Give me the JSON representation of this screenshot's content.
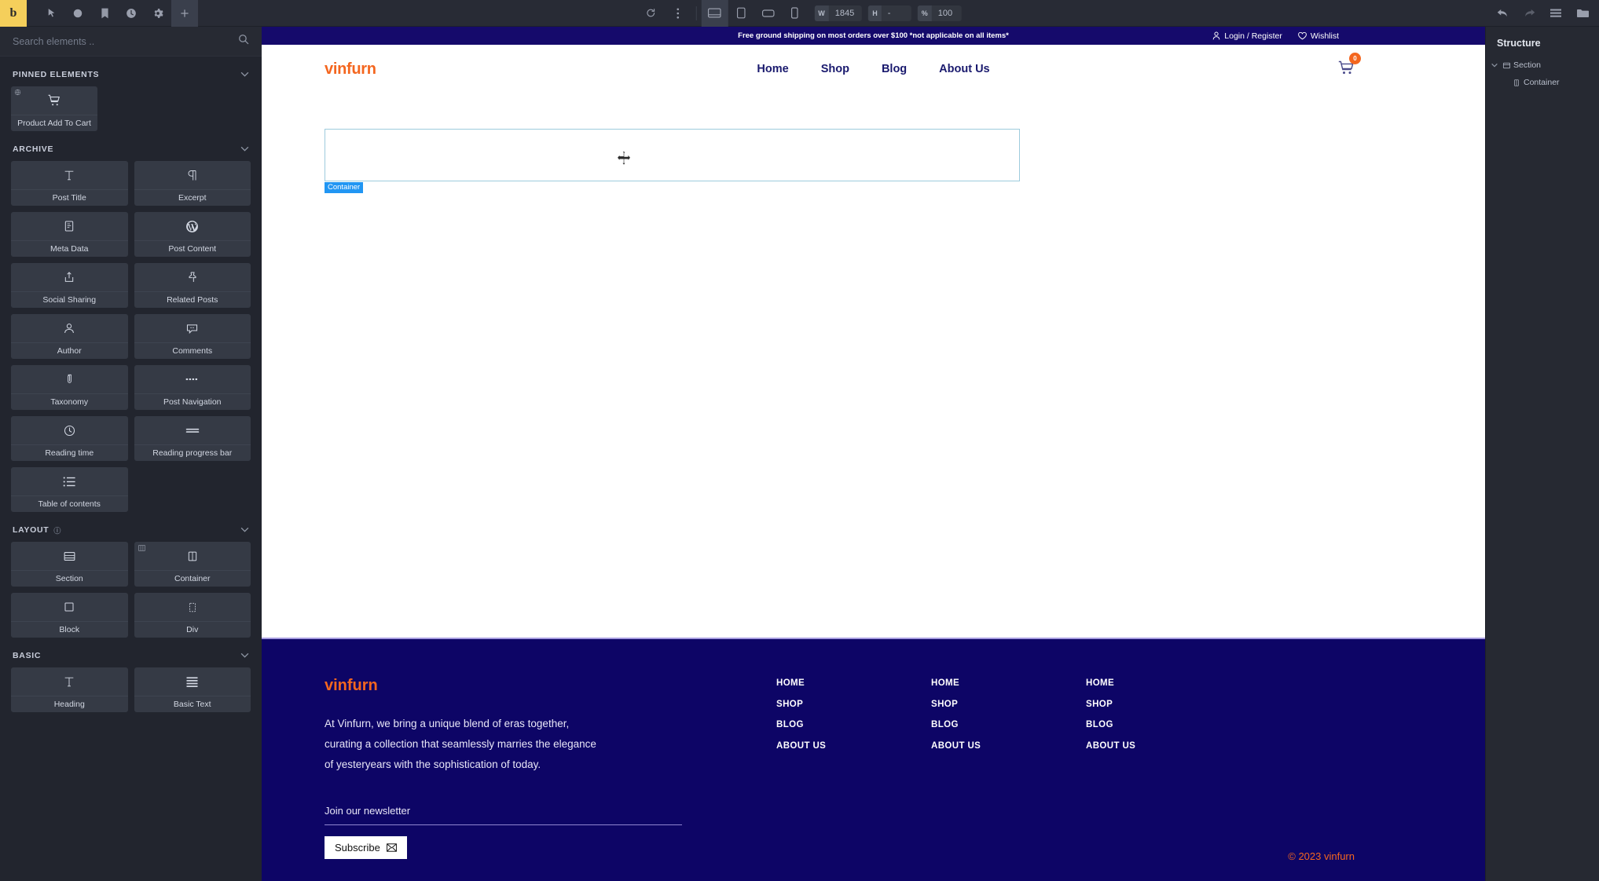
{
  "toolbar": {
    "logo": "b",
    "left_icons": [
      {
        "name": "cursor-icon",
        "title": "Select"
      },
      {
        "name": "help-icon",
        "title": "Help"
      },
      {
        "name": "book-icon",
        "title": "Pages"
      },
      {
        "name": "history-icon",
        "title": "History"
      },
      {
        "name": "gear-icon",
        "title": "Settings"
      },
      {
        "name": "add-icon",
        "title": "Add element"
      }
    ],
    "center": {
      "revision_icon": "refresh-icon",
      "more_icon": "more-vertical-icon",
      "devices": [
        {
          "name": "desktop-icon",
          "active": true
        },
        {
          "name": "tablet-portrait-icon",
          "active": false
        },
        {
          "name": "tablet-landscape-icon",
          "active": false
        },
        {
          "name": "mobile-icon",
          "active": false
        }
      ],
      "width_label": "W",
      "width_value": "1845",
      "height_label": "H",
      "height_value": "-",
      "zoom_label": "%",
      "zoom_value": "100"
    },
    "right_icons": [
      {
        "name": "undo-icon"
      },
      {
        "name": "redo-icon"
      },
      {
        "name": "list-icon"
      },
      {
        "name": "folder-icon"
      }
    ]
  },
  "left_panel": {
    "search": {
      "placeholder": "Search elements ..",
      "value": ""
    },
    "groups": [
      {
        "key": "pinned",
        "title": "PINNED ELEMENTS",
        "has_info": false,
        "items": [
          {
            "label": "Product Add To Cart",
            "icon": "shopping-cart-icon",
            "badge": "globe-icon"
          }
        ]
      },
      {
        "key": "archive",
        "title": "ARCHIVE",
        "has_info": false,
        "items": [
          {
            "label": "Post Title",
            "icon": "text-t-icon"
          },
          {
            "label": "Excerpt",
            "icon": "paragraph-icon"
          },
          {
            "label": "Meta Data",
            "icon": "metadata-icon"
          },
          {
            "label": "Post Content",
            "icon": "wordpress-icon"
          },
          {
            "label": "Social Sharing",
            "icon": "share-icon"
          },
          {
            "label": "Related Posts",
            "icon": "pin-icon"
          },
          {
            "label": "Author",
            "icon": "user-icon"
          },
          {
            "label": "Comments",
            "icon": "comment-icon"
          },
          {
            "label": "Taxonomy",
            "icon": "tag-icon"
          },
          {
            "label": "Post Navigation",
            "icon": "dots-row-icon"
          },
          {
            "label": "Reading time",
            "icon": "clock-icon"
          },
          {
            "label": "Reading progress bar",
            "icon": "progress-bar-icon"
          },
          {
            "label": "Table of contents",
            "icon": "list-bullets-icon"
          }
        ]
      },
      {
        "key": "layout",
        "title": "LAYOUT",
        "has_info": true,
        "items": [
          {
            "label": "Section",
            "icon": "section-icon"
          },
          {
            "label": "Container",
            "icon": "container-icon",
            "badge": "columns-icon"
          },
          {
            "label": "Block",
            "icon": "block-icon"
          },
          {
            "label": "Div",
            "icon": "div-icon"
          }
        ]
      },
      {
        "key": "basic",
        "title": "BASIC",
        "has_info": false,
        "items": [
          {
            "label": "Heading",
            "icon": "text-t-icon"
          },
          {
            "label": "Basic Text",
            "icon": "lines-icon"
          }
        ]
      }
    ]
  },
  "canvas": {
    "promo_bar": {
      "text": "Free ground shipping on most orders over $100 *not applicable on all items*",
      "login": "Login / Register",
      "wishlist": "Wishlist"
    },
    "header": {
      "logo": "vinfurn",
      "nav": [
        "Home",
        "Shop",
        "Blog",
        "About Us"
      ],
      "cart_icon": "shopping-cart-icon",
      "cart_count": "0"
    },
    "selection": {
      "label": "Container",
      "cursor_icon": "move-cursor-icon"
    },
    "footer": {
      "logo": "vinfurn",
      "description": "At Vinfurn, we bring a unique blend of eras together, curating a collection that seamlessly marries the elegance of yesteryears with the sophistication of today.",
      "newsletter_label": "Join our newsletter",
      "newsletter_value": "",
      "subscribe_label": "Subscribe",
      "subscribe_icon": "envelope-icon",
      "columns": [
        {
          "links": [
            "HOME",
            "SHOP",
            "BLOG",
            "ABOUT US"
          ]
        },
        {
          "links": [
            "HOME",
            "SHOP",
            "BLOG",
            "ABOUT US"
          ]
        },
        {
          "links": [
            "HOME",
            "SHOP",
            "BLOG",
            "ABOUT US"
          ]
        }
      ],
      "copyright": "© 2023 vinfurn"
    }
  },
  "right_panel": {
    "title": "Structure",
    "tree": [
      {
        "label": "Section",
        "depth": 0,
        "icon": "section-icon",
        "expanded": true
      },
      {
        "label": "Container",
        "depth": 1,
        "icon": "container-icon",
        "expanded": false
      }
    ]
  },
  "colors": {
    "brand_orange": "#f4661f",
    "site_navy": "#150a6b",
    "footer_navy": "#0d0566",
    "selection_blue": "#2196f3",
    "logo_yellow": "#f5cf5b"
  }
}
